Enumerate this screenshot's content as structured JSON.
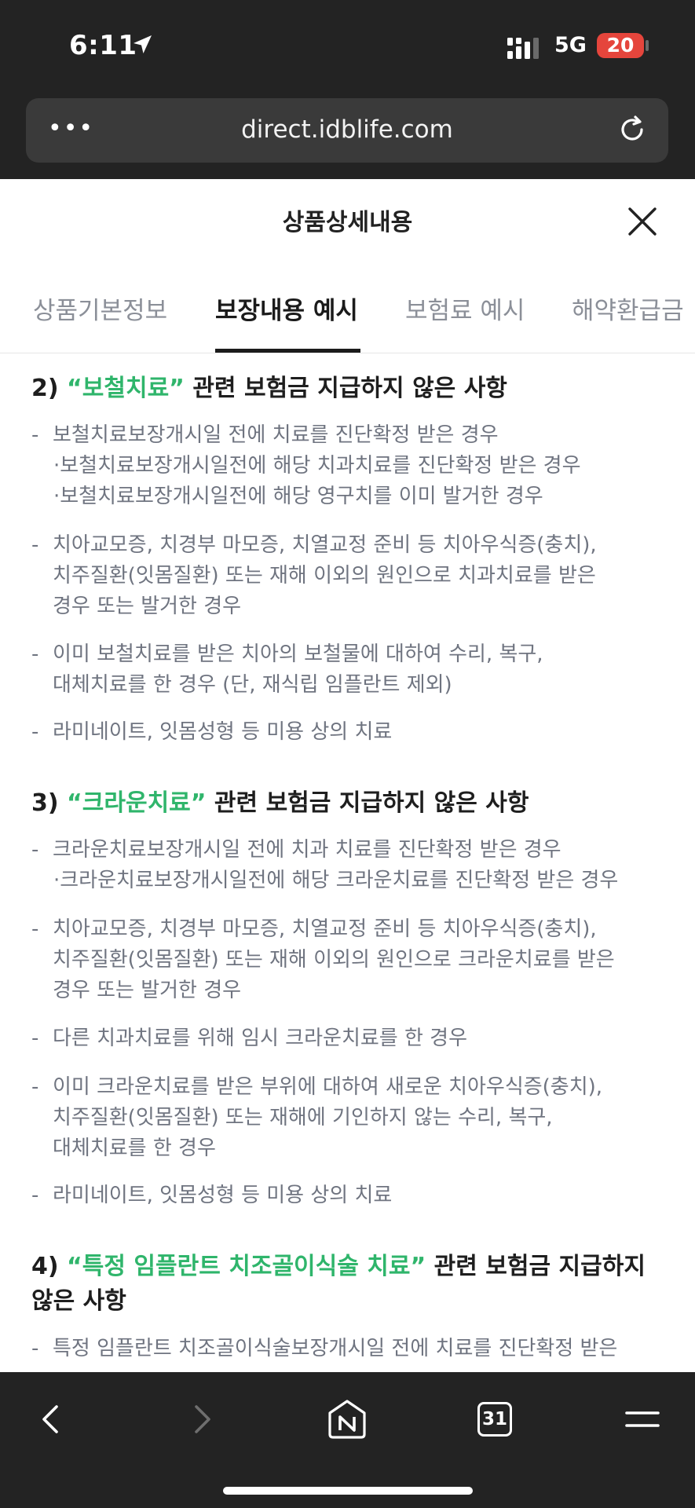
{
  "status_bar": {
    "time": "6:11",
    "network": "5G",
    "battery": "20"
  },
  "browser": {
    "url": "direct.idblife.com",
    "menu_dots": "•••"
  },
  "header": {
    "title": "상품상세내용"
  },
  "tabs": [
    {
      "label": "상품기본정보"
    },
    {
      "label": "보장내용 예시"
    },
    {
      "label": "보험료 예시"
    },
    {
      "label": "해약환급금"
    }
  ],
  "sections": [
    {
      "number": "2)",
      "highlight": "“보철치료”",
      "rest": " 관련 보험금 지급하지 않은 사항",
      "items": [
        {
          "text": "보철치료보장개시일 전에 치료를 진단확정 받은 경우",
          "subs": [
            "·보철치료보장개시일전에 해당 치과치료를 진단확정 받은 경우",
            "·보철치료보장개시일전에 해당 영구치를 이미 발거한 경우"
          ]
        },
        {
          "lines": [
            "치아교모증, 치경부 마모증, 치열교정 준비 등 치아우식증(충치),",
            "치주질환(잇몸질환) 또는 재해 이외의 원인으로 치과치료를 받은",
            "경우 또는 발거한 경우"
          ]
        },
        {
          "lines": [
            "이미 보철치료를 받은 치아의 보철물에 대하여 수리, 복구,",
            "대체치료를 한 경우 (단, 재식립 임플란트 제외)"
          ]
        },
        {
          "text": "라미네이트, 잇몸성형 등 미용 상의 치료"
        }
      ]
    },
    {
      "number": "3)",
      "highlight": "“크라운치료”",
      "rest": " 관련 보험금 지급하지 않은 사항",
      "items": [
        {
          "text": "크라운치료보장개시일 전에 치과 치료를 진단확정 받은 경우",
          "subs": [
            "·크라운치료보장개시일전에 해당 크라운치료를 진단확정 받은 경우"
          ]
        },
        {
          "lines": [
            "치아교모증, 치경부 마모증, 치열교정 준비 등 치아우식증(충치),",
            "치주질환(잇몸질환) 또는 재해 이외의 원인으로 크라운치료를 받은",
            "경우 또는 발거한 경우"
          ]
        },
        {
          "text": "다른 치과치료를 위해 임시 크라운치료를 한 경우"
        },
        {
          "lines": [
            "이미 크라운치료를 받은 부위에 대하여 새로운 치아우식증(충치),",
            "치주질환(잇몸질환) 또는 재해에 기인하지 않는 수리, 복구,",
            "대체치료를 한 경우"
          ]
        },
        {
          "text": "라미네이트, 잇몸성형 등 미용 상의 치료"
        }
      ]
    },
    {
      "number": "4)",
      "highlight": "“특정 임플란트 치조골이식술 치료”",
      "rest": " 관련 보험금 지급하지",
      "rest2": "않은 사항",
      "items": [
        {
          "text": "특정 임플란트 치조골이식술보장개시일 전에 치료를 진단확정 받은"
        }
      ]
    }
  ],
  "toolbar": {
    "tab_count": "31"
  },
  "colors": {
    "accent_green": "#2fb56b",
    "chrome_dark": "#232323",
    "battery_red": "#e5453c"
  }
}
